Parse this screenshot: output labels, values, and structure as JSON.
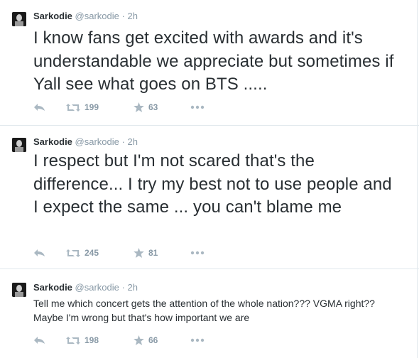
{
  "colors": {
    "text": "#292f33",
    "muted": "#8899a6",
    "icon": "#aab8c2",
    "divider": "#e1e8ed"
  },
  "tweets": [
    {
      "name": "Sarkodie",
      "handle": "@sarkodie",
      "separator": "·",
      "time": "2h",
      "text": "I know fans get excited with awards and it's understandable we appreciate but sometimes if Yall see what goes on BTS .....",
      "retweets": "199",
      "favorites": "63",
      "icons": [
        "reply-icon",
        "retweet-icon",
        "favorite-star-icon",
        "more-dots-icon"
      ]
    },
    {
      "name": "Sarkodie",
      "handle": "@sarkodie",
      "separator": "·",
      "time": "2h",
      "text": "I respect  but I'm not scared that's the difference... I try my best not to use people and I expect the same ... you can't blame me",
      "retweets": "245",
      "favorites": "81",
      "icons": [
        "reply-icon",
        "retweet-icon",
        "favorite-star-icon",
        "more-dots-icon"
      ]
    },
    {
      "name": "Sarkodie",
      "handle": "@sarkodie",
      "separator": "·",
      "time": "2h",
      "text": "Tell me which concert gets the attention of the whole nation??? VGMA right?? Maybe I'm wrong but that's how important we are",
      "retweets": "198",
      "favorites": "66",
      "icons": [
        "reply-icon",
        "retweet-icon",
        "favorite-star-icon",
        "more-dots-icon"
      ]
    }
  ]
}
